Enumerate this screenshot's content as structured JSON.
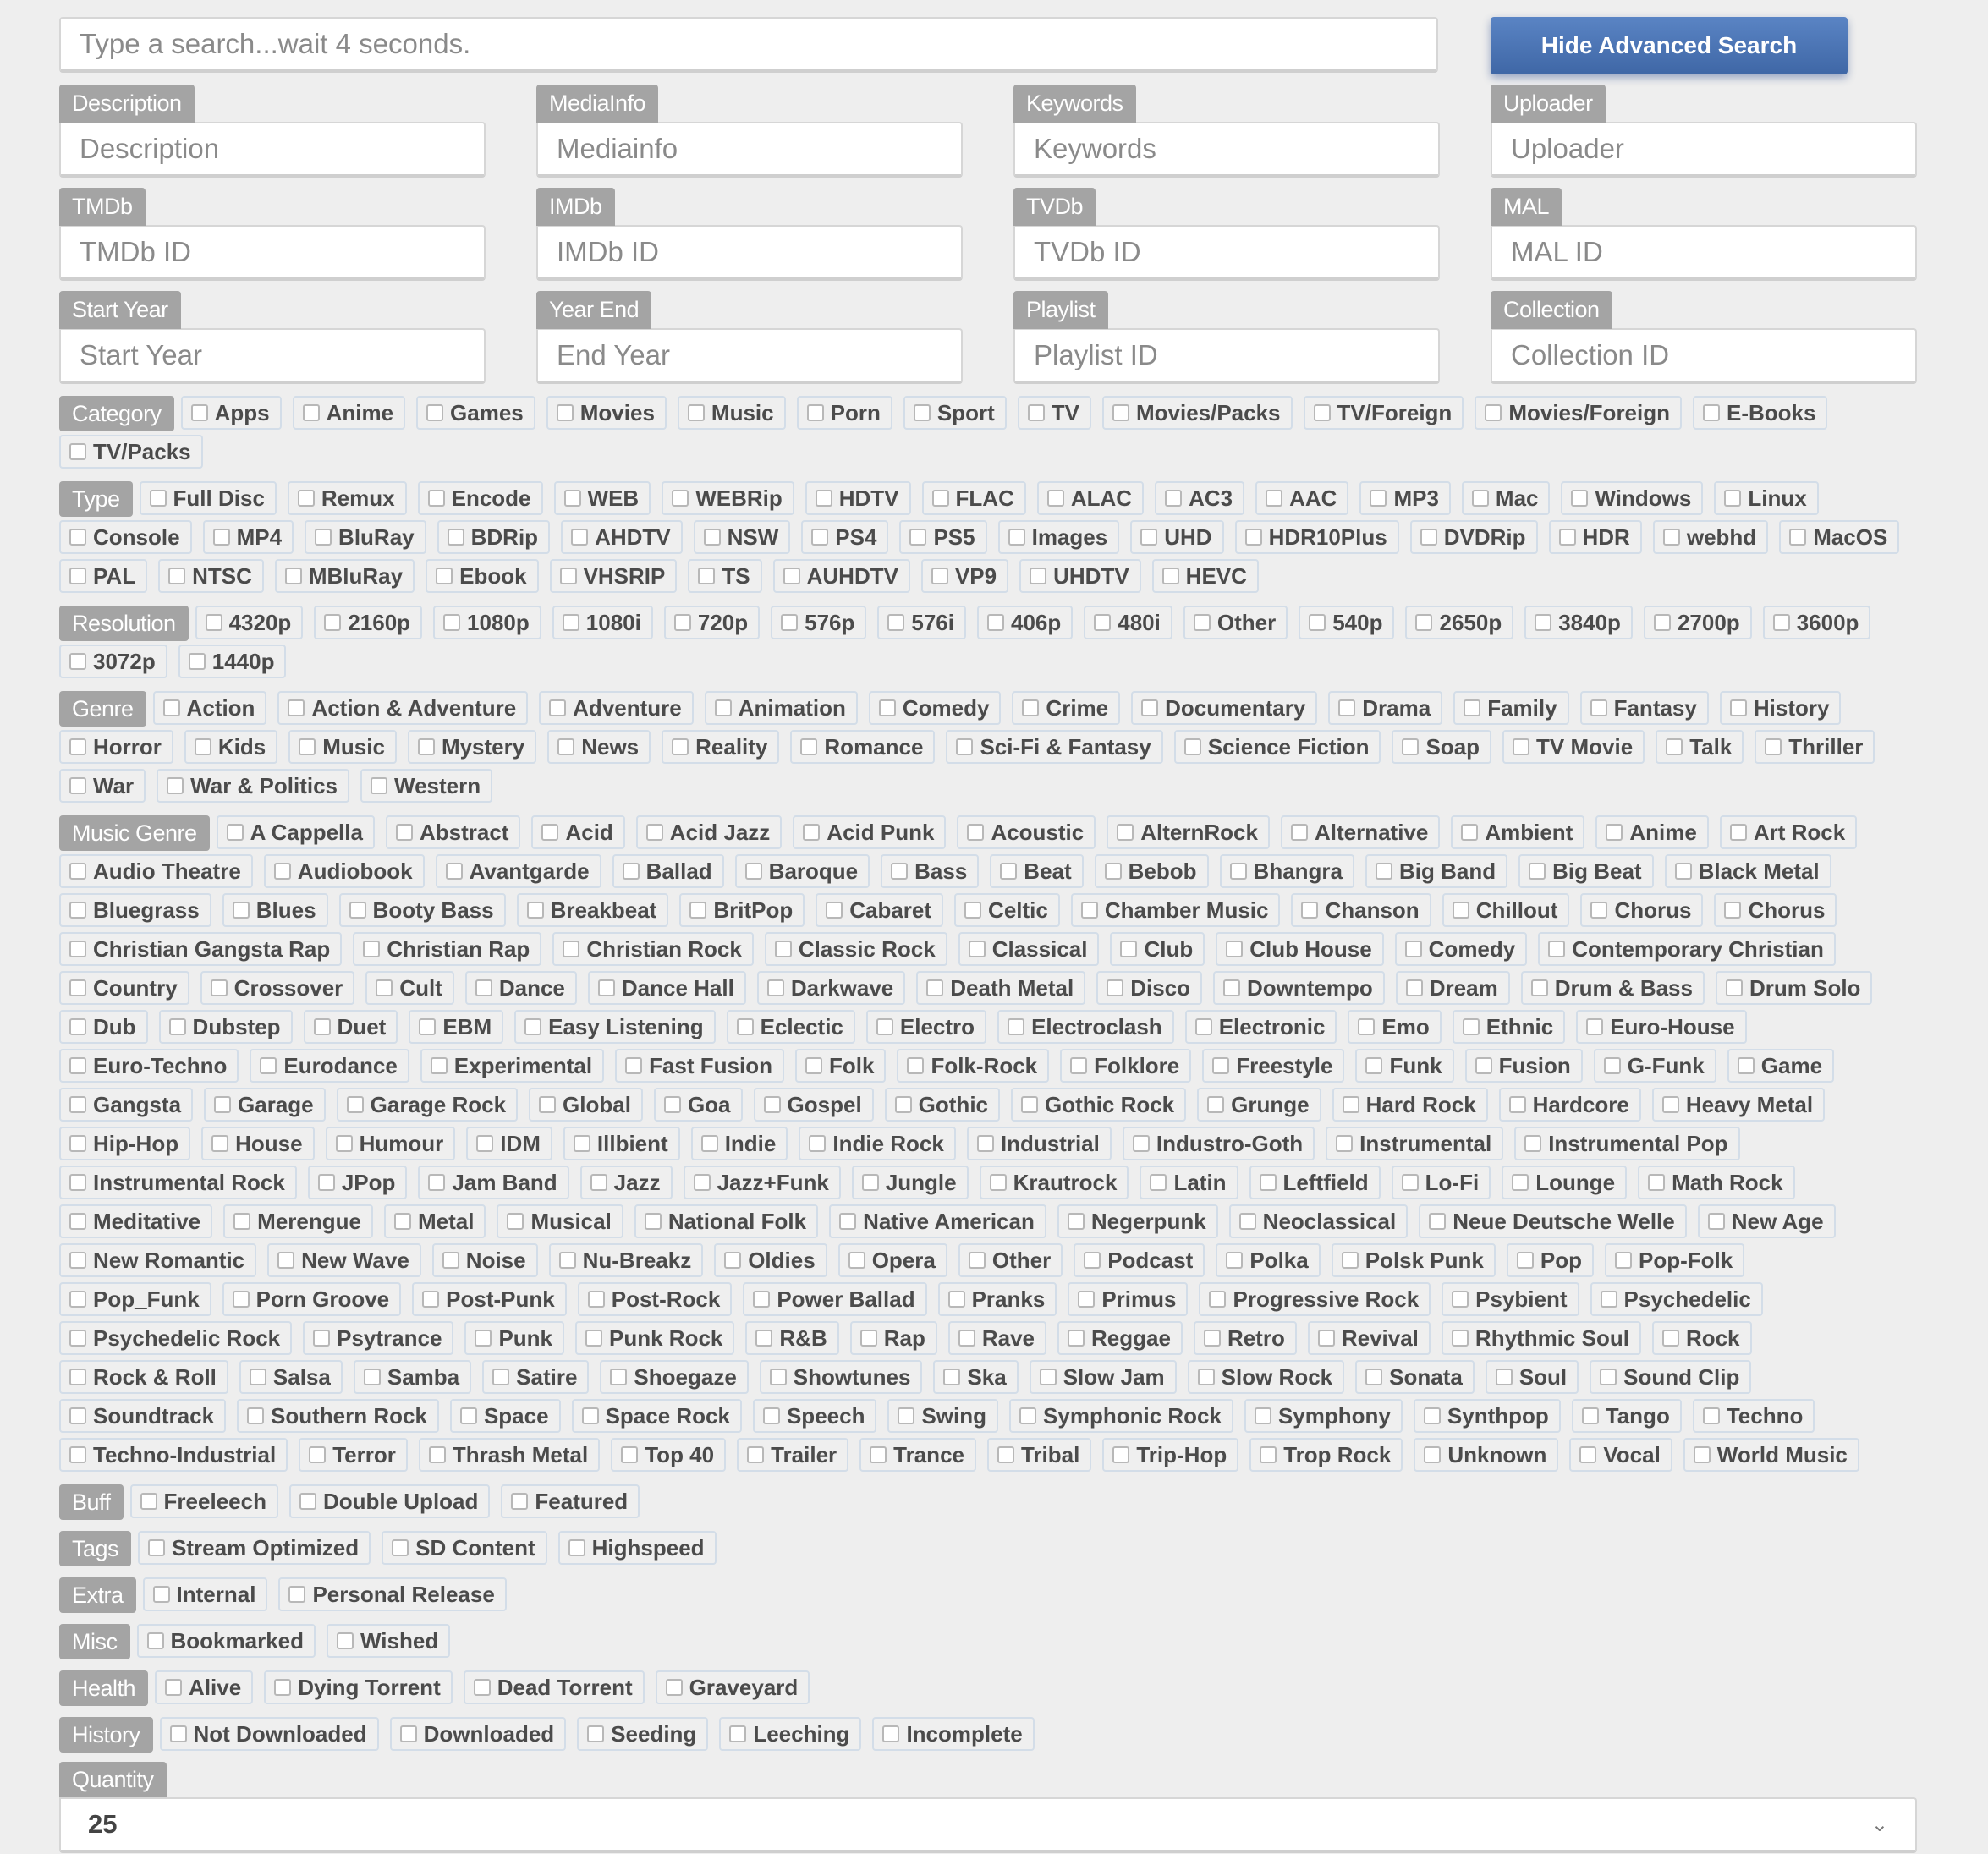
{
  "search": {
    "placeholder": "Type a search...wait 4 seconds.",
    "toggle_label": "Hide Advanced Search"
  },
  "fields": [
    {
      "label": "Description",
      "placeholder": "Description"
    },
    {
      "label": "MediaInfo",
      "placeholder": "Mediainfo"
    },
    {
      "label": "Keywords",
      "placeholder": "Keywords"
    },
    {
      "label": "Uploader",
      "placeholder": "Uploader"
    },
    {
      "label": "TMDb",
      "placeholder": "TMDb ID"
    },
    {
      "label": "IMDb",
      "placeholder": "IMDb ID"
    },
    {
      "label": "TVDb",
      "placeholder": "TVDb ID"
    },
    {
      "label": "MAL",
      "placeholder": "MAL ID"
    },
    {
      "label": "Start Year",
      "placeholder": "Start Year"
    },
    {
      "label": "Year End",
      "placeholder": "End Year"
    },
    {
      "label": "Playlist",
      "placeholder": "Playlist ID"
    },
    {
      "label": "Collection",
      "placeholder": "Collection ID"
    }
  ],
  "groups": [
    {
      "label": "Category",
      "options": [
        "Apps",
        "Anime",
        "Games",
        "Movies",
        "Music",
        "Porn",
        "Sport",
        "TV",
        "Movies/Packs",
        "TV/Foreign",
        "Movies/Foreign",
        "E-Books",
        "TV/Packs"
      ]
    },
    {
      "label": "Type",
      "options": [
        "Full Disc",
        "Remux",
        "Encode",
        "WEB",
        "WEBRip",
        "HDTV",
        "FLAC",
        "ALAC",
        "AC3",
        "AAC",
        "MP3",
        "Mac",
        "Windows",
        "Linux",
        "Console",
        "MP4",
        "BluRay",
        "BDRip",
        "AHDTV",
        "NSW",
        "PS4",
        "PS5",
        "Images",
        "UHD",
        "HDR10Plus",
        "DVDRip",
        "HDR",
        "webhd",
        "MacOS",
        "PAL",
        "NTSC",
        "MBluRay",
        "Ebook",
        "VHSRIP",
        "TS",
        "AUHDTV",
        "VP9",
        "UHDTV",
        "HEVC"
      ]
    },
    {
      "label": "Resolution",
      "options": [
        "4320p",
        "2160p",
        "1080p",
        "1080i",
        "720p",
        "576p",
        "576i",
        "406p",
        "480i",
        "Other",
        "540p",
        "2650p",
        "3840p",
        "2700p",
        "3600p",
        "3072p",
        "1440p"
      ]
    },
    {
      "label": "Genre",
      "options": [
        "Action",
        "Action & Adventure",
        "Adventure",
        "Animation",
        "Comedy",
        "Crime",
        "Documentary",
        "Drama",
        "Family",
        "Fantasy",
        "History",
        "Horror",
        "Kids",
        "Music",
        "Mystery",
        "News",
        "Reality",
        "Romance",
        "Sci-Fi & Fantasy",
        "Science Fiction",
        "Soap",
        "TV Movie",
        "Talk",
        "Thriller",
        "War",
        "War & Politics",
        "Western"
      ]
    },
    {
      "label": "Music Genre",
      "options": [
        "A Cappella",
        "Abstract",
        "Acid",
        "Acid Jazz",
        "Acid Punk",
        "Acoustic",
        "AlternRock",
        "Alternative",
        "Ambient",
        "Anime",
        "Art Rock",
        "Audio Theatre",
        "Audiobook",
        "Avantgarde",
        "Ballad",
        "Baroque",
        "Bass",
        "Beat",
        "Bebob",
        "Bhangra",
        "Big Band",
        "Big Beat",
        "Black Metal",
        "Bluegrass",
        "Blues",
        "Booty Bass",
        "Breakbeat",
        "BritPop",
        "Cabaret",
        "Celtic",
        "Chamber Music",
        "Chanson",
        "Chillout",
        "Chorus",
        "Chorus",
        "Christian Gangsta Rap",
        "Christian Rap",
        "Christian Rock",
        "Classic Rock",
        "Classical",
        "Club",
        "Club House",
        "Comedy",
        "Contemporary Christian",
        "Country",
        "Crossover",
        "Cult",
        "Dance",
        "Dance Hall",
        "Darkwave",
        "Death Metal",
        "Disco",
        "Downtempo",
        "Dream",
        "Drum & Bass",
        "Drum Solo",
        "Dub",
        "Dubstep",
        "Duet",
        "EBM",
        "Easy Listening",
        "Eclectic",
        "Electro",
        "Electroclash",
        "Electronic",
        "Emo",
        "Ethnic",
        "Euro-House",
        "Euro-Techno",
        "Eurodance",
        "Experimental",
        "Fast Fusion",
        "Folk",
        "Folk-Rock",
        "Folklore",
        "Freestyle",
        "Funk",
        "Fusion",
        "G-Funk",
        "Game",
        "Gangsta",
        "Garage",
        "Garage Rock",
        "Global",
        "Goa",
        "Gospel",
        "Gothic",
        "Gothic Rock",
        "Grunge",
        "Hard Rock",
        "Hardcore",
        "Heavy Metal",
        "Hip-Hop",
        "House",
        "Humour",
        "IDM",
        "Illbient",
        "Indie",
        "Indie Rock",
        "Industrial",
        "Industro-Goth",
        "Instrumental",
        "Instrumental Pop",
        "Instrumental Rock",
        "JPop",
        "Jam Band",
        "Jazz",
        "Jazz+Funk",
        "Jungle",
        "Krautrock",
        "Latin",
        "Leftfield",
        "Lo-Fi",
        "Lounge",
        "Math Rock",
        "Meditative",
        "Merengue",
        "Metal",
        "Musical",
        "National Folk",
        "Native American",
        "Negerpunk",
        "Neoclassical",
        "Neue Deutsche Welle",
        "New Age",
        "New Romantic",
        "New Wave",
        "Noise",
        "Nu-Breakz",
        "Oldies",
        "Opera",
        "Other",
        "Podcast",
        "Polka",
        "Polsk Punk",
        "Pop",
        "Pop-Folk",
        "Pop_Funk",
        "Porn Groove",
        "Post-Punk",
        "Post-Rock",
        "Power Ballad",
        "Pranks",
        "Primus",
        "Progressive Rock",
        "Psybient",
        "Psychedelic",
        "Psychedelic Rock",
        "Psytrance",
        "Punk",
        "Punk Rock",
        "R&B",
        "Rap",
        "Rave",
        "Reggae",
        "Retro",
        "Revival",
        "Rhythmic Soul",
        "Rock",
        "Rock & Roll",
        "Salsa",
        "Samba",
        "Satire",
        "Shoegaze",
        "Showtunes",
        "Ska",
        "Slow Jam",
        "Slow Rock",
        "Sonata",
        "Soul",
        "Sound Clip",
        "Soundtrack",
        "Southern Rock",
        "Space",
        "Space Rock",
        "Speech",
        "Swing",
        "Symphonic Rock",
        "Symphony",
        "Synthpop",
        "Tango",
        "Techno",
        "Techno-Industrial",
        "Terror",
        "Thrash Metal",
        "Top 40",
        "Trailer",
        "Trance",
        "Tribal",
        "Trip-Hop",
        "Trop Rock",
        "Unknown",
        "Vocal",
        "World Music"
      ]
    },
    {
      "label": "Buff",
      "options": [
        "Freeleech",
        "Double Upload",
        "Featured"
      ]
    },
    {
      "label": "Tags",
      "options": [
        "Stream Optimized",
        "SD Content",
        "Highspeed"
      ]
    },
    {
      "label": "Extra",
      "options": [
        "Internal",
        "Personal Release"
      ]
    },
    {
      "label": "Misc",
      "options": [
        "Bookmarked",
        "Wished"
      ]
    },
    {
      "label": "Health",
      "options": [
        "Alive",
        "Dying Torrent",
        "Dead Torrent",
        "Graveyard"
      ]
    },
    {
      "label": "History",
      "options": [
        "Not Downloaded",
        "Downloaded",
        "Seeding",
        "Leeching",
        "Incomplete"
      ]
    }
  ],
  "quantity": {
    "label": "Quantity",
    "value": "25"
  }
}
